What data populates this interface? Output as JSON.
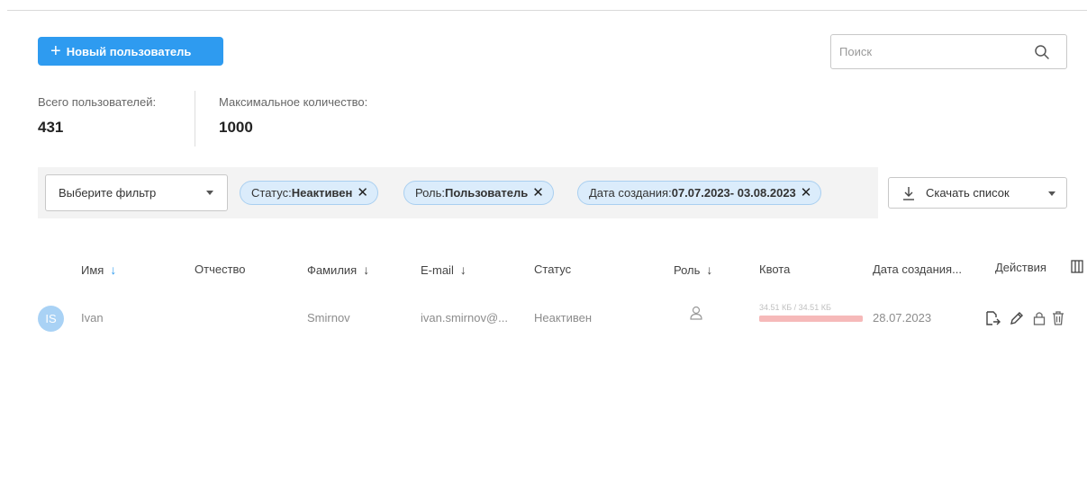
{
  "toolbar": {
    "new_user_label": "Новый пользователь",
    "search_placeholder": "Поиск"
  },
  "stats": {
    "total_label": "Всего пользователей:",
    "total_value": "431",
    "max_label": "Максимальное количество:",
    "max_value": "1000"
  },
  "filters": {
    "select_label": "Выберите фильтр",
    "chips": [
      {
        "key": "Статус: ",
        "value": "Неактивен"
      },
      {
        "key": "Роль: ",
        "value": "Пользователь"
      },
      {
        "key": "Дата создания: ",
        "value": "07.07.2023- 03.08.2023"
      }
    ],
    "download_label": "Скачать список"
  },
  "table": {
    "columns": {
      "name": "Имя",
      "patronymic": "Отчество",
      "surname": "Фамилия",
      "email": "E-mail",
      "status": "Статус",
      "role": "Роль",
      "quota": "Квота",
      "created": "Дата создания...",
      "actions": "Действия"
    },
    "rows": [
      {
        "initials": "IS",
        "name": "Ivan",
        "patronymic": "",
        "surname": "Smirnov",
        "email": "ivan.smirnov@...",
        "status": "Неактивен",
        "role_icon": "user-icon",
        "quota_text": "34.51 КБ / 34.51 КБ",
        "quota_fraction": 1.0,
        "created": "28.07.2023"
      }
    ]
  },
  "colors": {
    "accent": "#2e9bf0",
    "chip_bg": "#dbecfb",
    "quota_bar": "#f8caca"
  },
  "icons": [
    "plus-icon",
    "search-icon",
    "download-icon",
    "close-icon",
    "user-icon",
    "login-as-icon",
    "edit-icon",
    "lock-icon",
    "delete-icon",
    "columns-icon"
  ]
}
